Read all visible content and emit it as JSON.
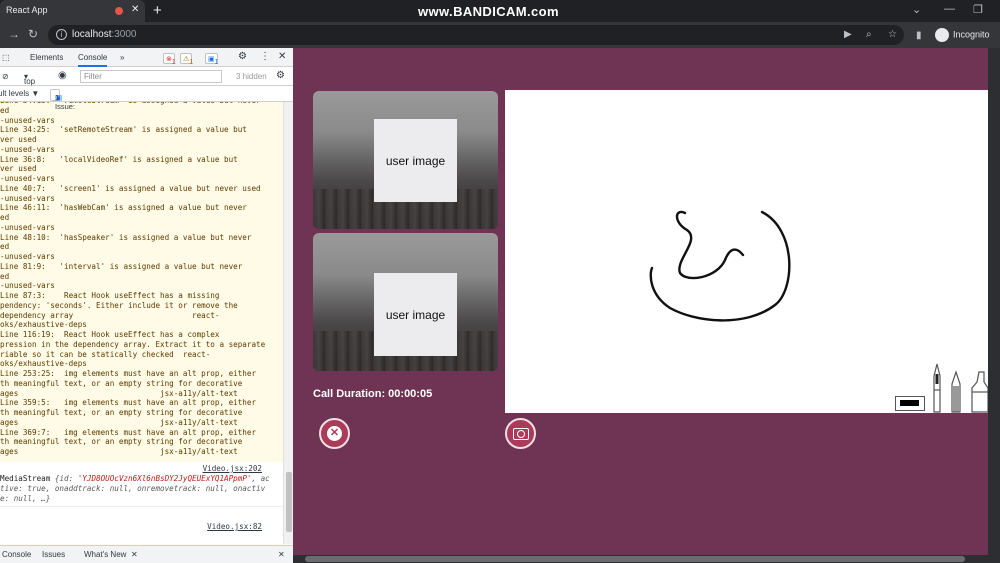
{
  "browser": {
    "tab_title": "React App",
    "tab_close": "✕",
    "new_tab": "+",
    "watermark": "www.BANDICAM.com",
    "url_host": "localhost",
    "url_port": ":3000",
    "profile_label": "Incognito"
  },
  "devtools": {
    "tabs": [
      "Elements",
      "Console"
    ],
    "more_tabs": "»",
    "error_count": "1",
    "warning_count": "1",
    "message_count": "1",
    "context": "top",
    "filter_placeholder": "Filter",
    "hidden_count": "3 hidden",
    "levels": "ult levels ▼",
    "issues_label": "1 Issue:",
    "issues_count": "1",
    "log_lines": [
      "Line 34:13:  'remoteStream' is assigned a value but never",
      "ed",
      "-unused-vars",
      "Line 34:25:  'setRemoteStream' is assigned a value but",
      "ver used",
      "-unused-vars",
      "Line 36:8:   'localVideoRef' is assigned a value but",
      "ver used",
      "-unused-vars",
      "Line 40:7:   'screen1' is assigned a value but never used",
      "-unused-vars",
      "Line 46:11:  'hasWebCam' is assigned a value but never",
      "ed",
      "-unused-vars",
      "Line 48:10:  'hasSpeaker' is assigned a value but never",
      "ed",
      "-unused-vars",
      "Line 81:9:   'interval' is assigned a value but never",
      "ed",
      "-unused-vars",
      "Line 87:3:    React Hook useEffect has a missing",
      "pendency: 'seconds'. Either include it or remove the",
      "dependency array                          react-",
      "oks/exhaustive-deps",
      "Line 116:19:  React Hook useEffect has a complex",
      "pression in the dependency array. Extract it to a separate",
      "riable so it can be statically checked  react-",
      "oks/exhaustive-deps",
      "Line 253:25:  img elements must have an alt prop, either",
      "th meaningful text, or an empty string for decorative",
      "ages                               jsx-a11y/alt-text",
      "Line 359:5:   img elements must have an alt prop, either",
      "th meaningful text, or an empty string for decorative",
      "ages                               jsx-a11y/alt-text",
      "Line 369:7:   img elements must have an alt prop, either",
      "th meaningful text, or an empty string for decorative",
      "ages                               jsx-a11y/alt-text"
    ],
    "entry_source_1": "Video.jsx:202",
    "mediastream_label": "MediaStream",
    "mediastream_rest_1": " {id: ",
    "mediastream_id": "'YJD8OUOcVzn6Xl6nBsDY2JyQEUExYQ1APpmP'",
    "mediastream_rest_2": ", ac",
    "mediastream_line_2": "tive: true, onaddtrack: null, onremovetrack: null, onactiv",
    "mediastream_line_3": "e: null, …}",
    "entry_source_2": "Video.jsx:82",
    "drawer_tabs": [
      "Console",
      "Issues",
      "What's New"
    ],
    "drawer_close": "✕"
  },
  "app": {
    "tiles": [
      {
        "label": "user image"
      },
      {
        "label": "user image"
      }
    ],
    "call_duration": "Call Duration: 00:00:05",
    "end_call_glyph": "✕"
  },
  "colors": {
    "page_bg": "#6f3453",
    "button_bg": "#a93d59",
    "canvas_bg": "#ffffff"
  }
}
